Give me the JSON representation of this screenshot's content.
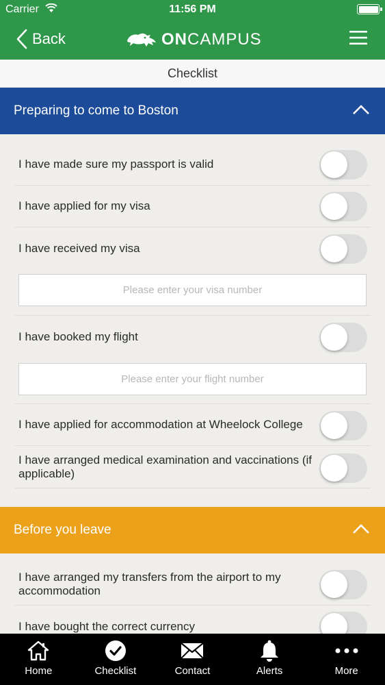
{
  "status_bar": {
    "carrier": "Carrier",
    "time": "11:56 PM"
  },
  "nav": {
    "back_label": "Back",
    "brand_bold": "ON",
    "brand_light": "CAMPUS"
  },
  "page_title": "Checklist",
  "sections": [
    {
      "title": "Preparing to come to Boston",
      "color": "#1b4b99",
      "items": [
        {
          "label": "I have made sure my passport is valid",
          "checked": false
        },
        {
          "label": "I have applied for my visa",
          "checked": false
        },
        {
          "label": "I have received my visa",
          "checked": false,
          "input_placeholder": "Please enter your visa number"
        },
        {
          "label": "I have booked my flight",
          "checked": false,
          "input_placeholder": "Please enter your flight number"
        },
        {
          "label": "I have applied for accommodation at Wheelock College",
          "checked": false
        },
        {
          "label": "I have arranged medical examination and vaccinations (if applicable)",
          "checked": false
        }
      ]
    },
    {
      "title": "Before you leave",
      "color": "#eca11b",
      "items": [
        {
          "label": "I have arranged my transfers from the airport to my accommodation",
          "checked": false
        },
        {
          "label": "I have bought the correct currency",
          "checked": false
        }
      ]
    }
  ],
  "tabs": [
    {
      "label": "Home",
      "icon": "home-icon"
    },
    {
      "label": "Checklist",
      "icon": "checkmark-circle-icon"
    },
    {
      "label": "Contact",
      "icon": "envelope-icon"
    },
    {
      "label": "Alerts",
      "icon": "bell-icon"
    },
    {
      "label": "More",
      "icon": "more-dots-icon"
    }
  ],
  "colors": {
    "header_green": "#2f974a",
    "toggle_off": "#dcdcdc",
    "tabbar": "#000000"
  }
}
